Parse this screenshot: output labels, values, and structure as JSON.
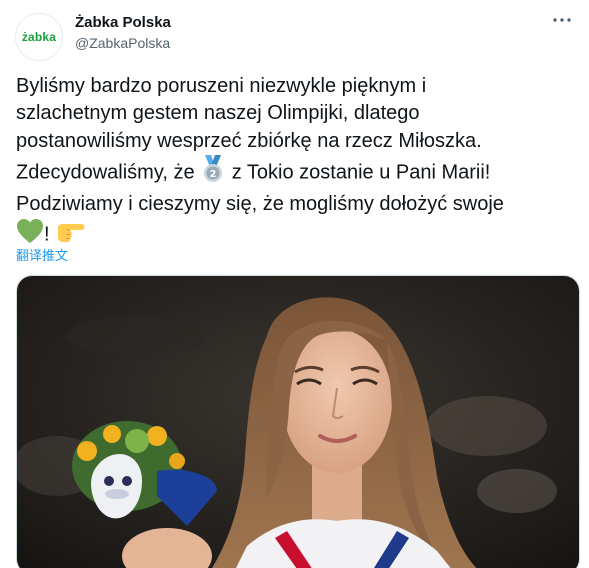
{
  "account": {
    "avatar_text": "żabka",
    "name": "Żabka Polska",
    "handle": "@ZabkaPolska"
  },
  "tweet": {
    "line1": "Byliśmy bardzo poruszeni niezwykle pięknym i",
    "line2": "szlachetnym gestem naszej Olimpijki, dlatego",
    "line3": "postanowiliśmy wesprzeć zbiórkę na rzecz Miłoszka.",
    "line4_before": "Zdecydowaliśmy, że ",
    "line4_after": " z Tokio zostanie u Pani Marii!",
    "line5": "Podziwiamy i cieszymy się, że mogliśmy dołożyć swoje",
    "line6_after": "! ",
    "emojis": [
      "second-place-medal",
      "green-heart",
      "pointing-right-hand"
    ]
  },
  "translate_label": "翻译推文",
  "more_icon": "more-options-icon",
  "colors": {
    "brand_green": "#1a9f3c",
    "link_blue": "#1d9bf0",
    "text_primary": "#0f1419",
    "text_secondary": "#536471"
  }
}
